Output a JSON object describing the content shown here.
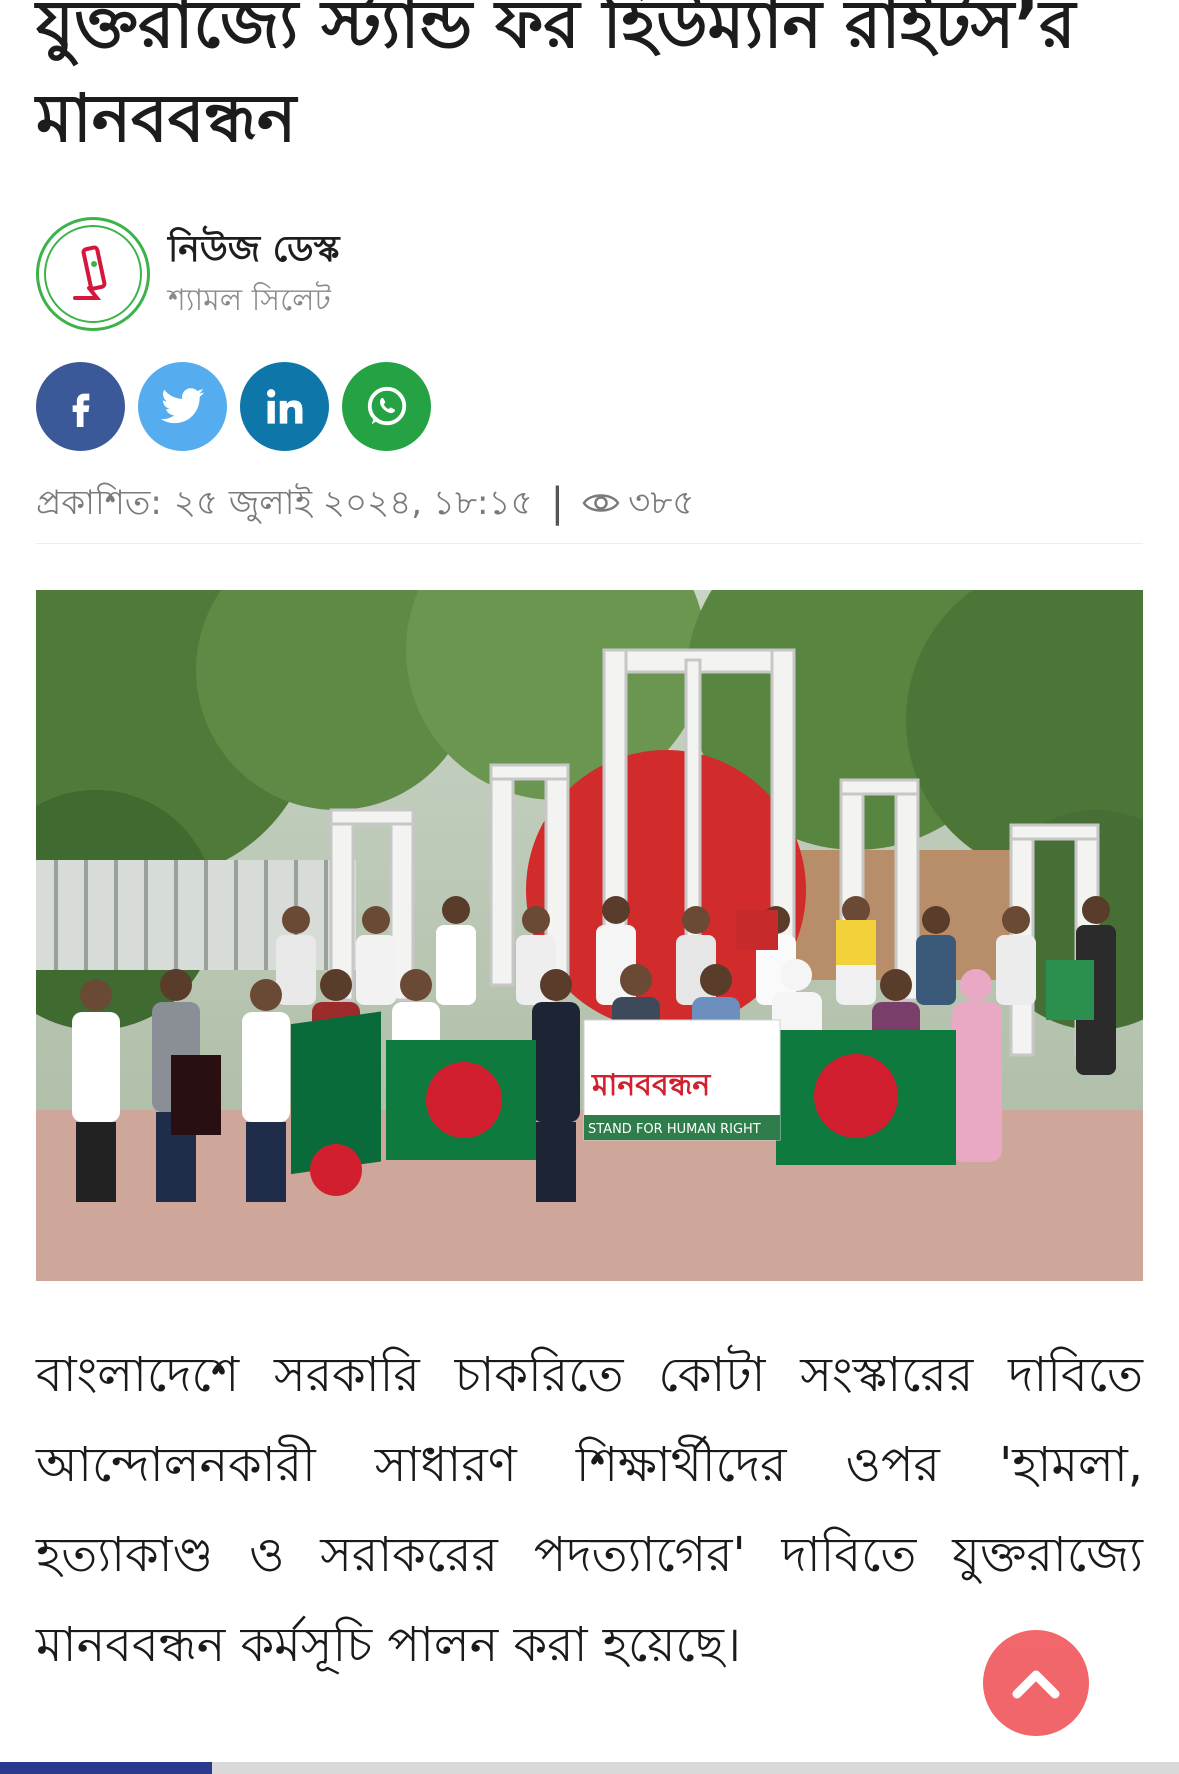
{
  "article": {
    "headline": "যুক্তরাজ্যে স্ট্যান্ড ফর হিউম্যান রাইটস’র মানববন্ধন",
    "author_name": "নিউজ ডেস্ক",
    "author_org": "শ্যামল সিলেট",
    "published_label": "প্রকাশিত:",
    "published_date": "২৫ জুলাই ২০২৪, ১৮:১৫",
    "views": "৩৮৫",
    "body": "বাংলাদেশে সরকারি চাকরিতে কোটা সংস্কারের দাবিতে আন্দোলনকারী সাধারণ শিক্ষার্থীদের ওপর 'হামলা, হত্যাকাণ্ড ও সরাকরের পদত্যাগের' দাবিতে যুক্তরাজ্যে মানববন্ধন কর্মসূচি পালন করা হয়েছে।"
  },
  "photo": {
    "banner_text": "মানববন্ধন",
    "banner_subtext": "STAND FOR HUMAN RIGHT"
  },
  "share": {
    "buttons": [
      "facebook-icon",
      "twitter-icon",
      "linkedin-icon",
      "whatsapp-icon"
    ]
  },
  "colors": {
    "facebook": "#3b5998",
    "twitter": "#55acee",
    "linkedin": "#0e76a8",
    "whatsapp": "#25a244",
    "scroll_top": "#f05a5e",
    "avatar_ring": "#3cb34a",
    "progress": "#2a3a8f"
  },
  "reading_progress": 0.18
}
